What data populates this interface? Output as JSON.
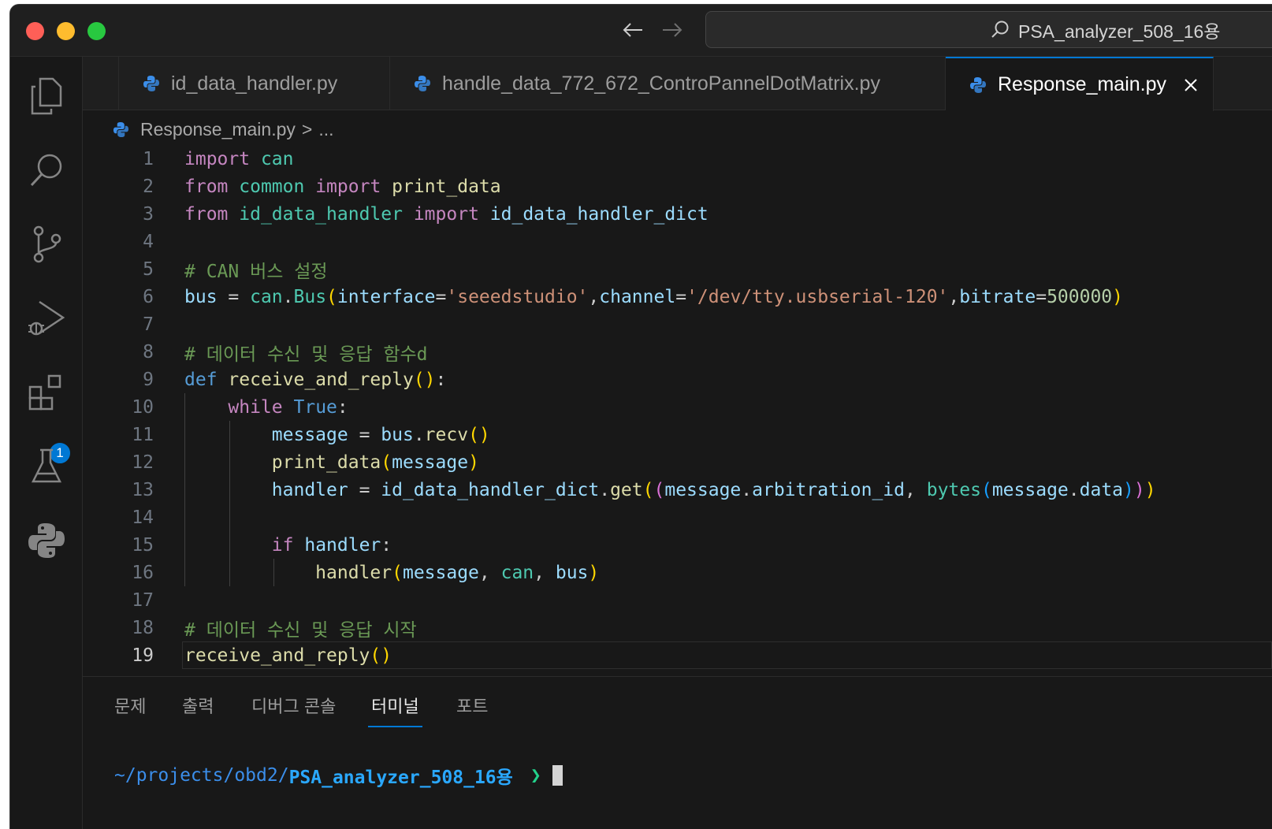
{
  "titlebar": {
    "search_text": "PSA_analyzer_508_16용",
    "back_icon": "arrow-left-icon",
    "forward_icon": "arrow-right-icon"
  },
  "activity_bar": {
    "items": [
      "explorer-icon",
      "search-icon",
      "source-control-icon",
      "run-debug-icon",
      "extensions-icon",
      "testing-icon",
      "python-icon"
    ],
    "extensions_badge": "1"
  },
  "tabs": [
    {
      "label": "id_data_handler.py",
      "active": false
    },
    {
      "label": "handle_data_772_672_ControPannelDotMatrix.py",
      "active": false
    },
    {
      "label": "Response_main.py",
      "active": true
    }
  ],
  "breadcrumb": {
    "file": "Response_main.py",
    "separator": ">",
    "rest": "..."
  },
  "editor": {
    "current_line": 19,
    "line_numbers": [
      "1",
      "2",
      "3",
      "4",
      "5",
      "6",
      "7",
      "8",
      "9",
      "10",
      "11",
      "12",
      "13",
      "14",
      "15",
      "16",
      "17",
      "18",
      "19"
    ],
    "tokens": {
      "l1": [
        "import",
        "can"
      ],
      "l2": [
        "from",
        "common",
        "import",
        "print_data"
      ],
      "l3": [
        "from",
        "id_data_handler",
        "import",
        "id_data_handler_dict"
      ],
      "l5": "# CAN 버스 설정",
      "l6": [
        "bus",
        " = ",
        "can",
        ".",
        "Bus",
        "(",
        "interface",
        "=",
        "'seeedstudio'",
        ",",
        "channel",
        "=",
        "'/dev/tty.usbserial-120'",
        ",",
        "bitrate",
        "=",
        "500000",
        ")"
      ],
      "l8": "# 데이터 수신 및 응답 함수d",
      "l9": [
        "def",
        "receive_and_reply",
        "(",
        ")",
        ":"
      ],
      "l10": [
        "while",
        "True",
        ":"
      ],
      "l11": [
        "message",
        " = ",
        "bus",
        ".",
        "recv",
        "(",
        ")"
      ],
      "l12": [
        "print_data",
        "(",
        "message",
        ")"
      ],
      "l13": [
        "handler",
        " = ",
        "id_data_handler_dict",
        ".",
        "get",
        "(",
        "(",
        "message",
        ".",
        "arbitration_id",
        ", ",
        "bytes",
        "(",
        "message",
        ".",
        "data",
        ")",
        ")",
        ")"
      ],
      "l15": [
        "if",
        "handler",
        ":"
      ],
      "l16": [
        "handler",
        "(",
        "message",
        ", ",
        "can",
        ", ",
        "bus",
        ")"
      ],
      "l18": "# 데이터 수신 및 응답 시작",
      "l19": [
        "receive_and_reply",
        "(",
        ")"
      ]
    }
  },
  "panel": {
    "tabs": [
      "문제",
      "출력",
      "디버그 콘솔",
      "터미널",
      "포트"
    ],
    "active_tab": "터미널",
    "terminal": {
      "path_prefix": "~/projects/obd2/",
      "dir": "PSA_analyzer_508_16용",
      "prompt": "❯"
    }
  },
  "colors": {
    "accent": "#0078d4",
    "background": "#181818",
    "keyword": "#c586c0",
    "module": "#4ec9b0",
    "function": "#dcdcaa",
    "variable": "#9cdcfe",
    "string": "#ce9178",
    "number": "#b5cea8",
    "comment": "#6a9955"
  }
}
